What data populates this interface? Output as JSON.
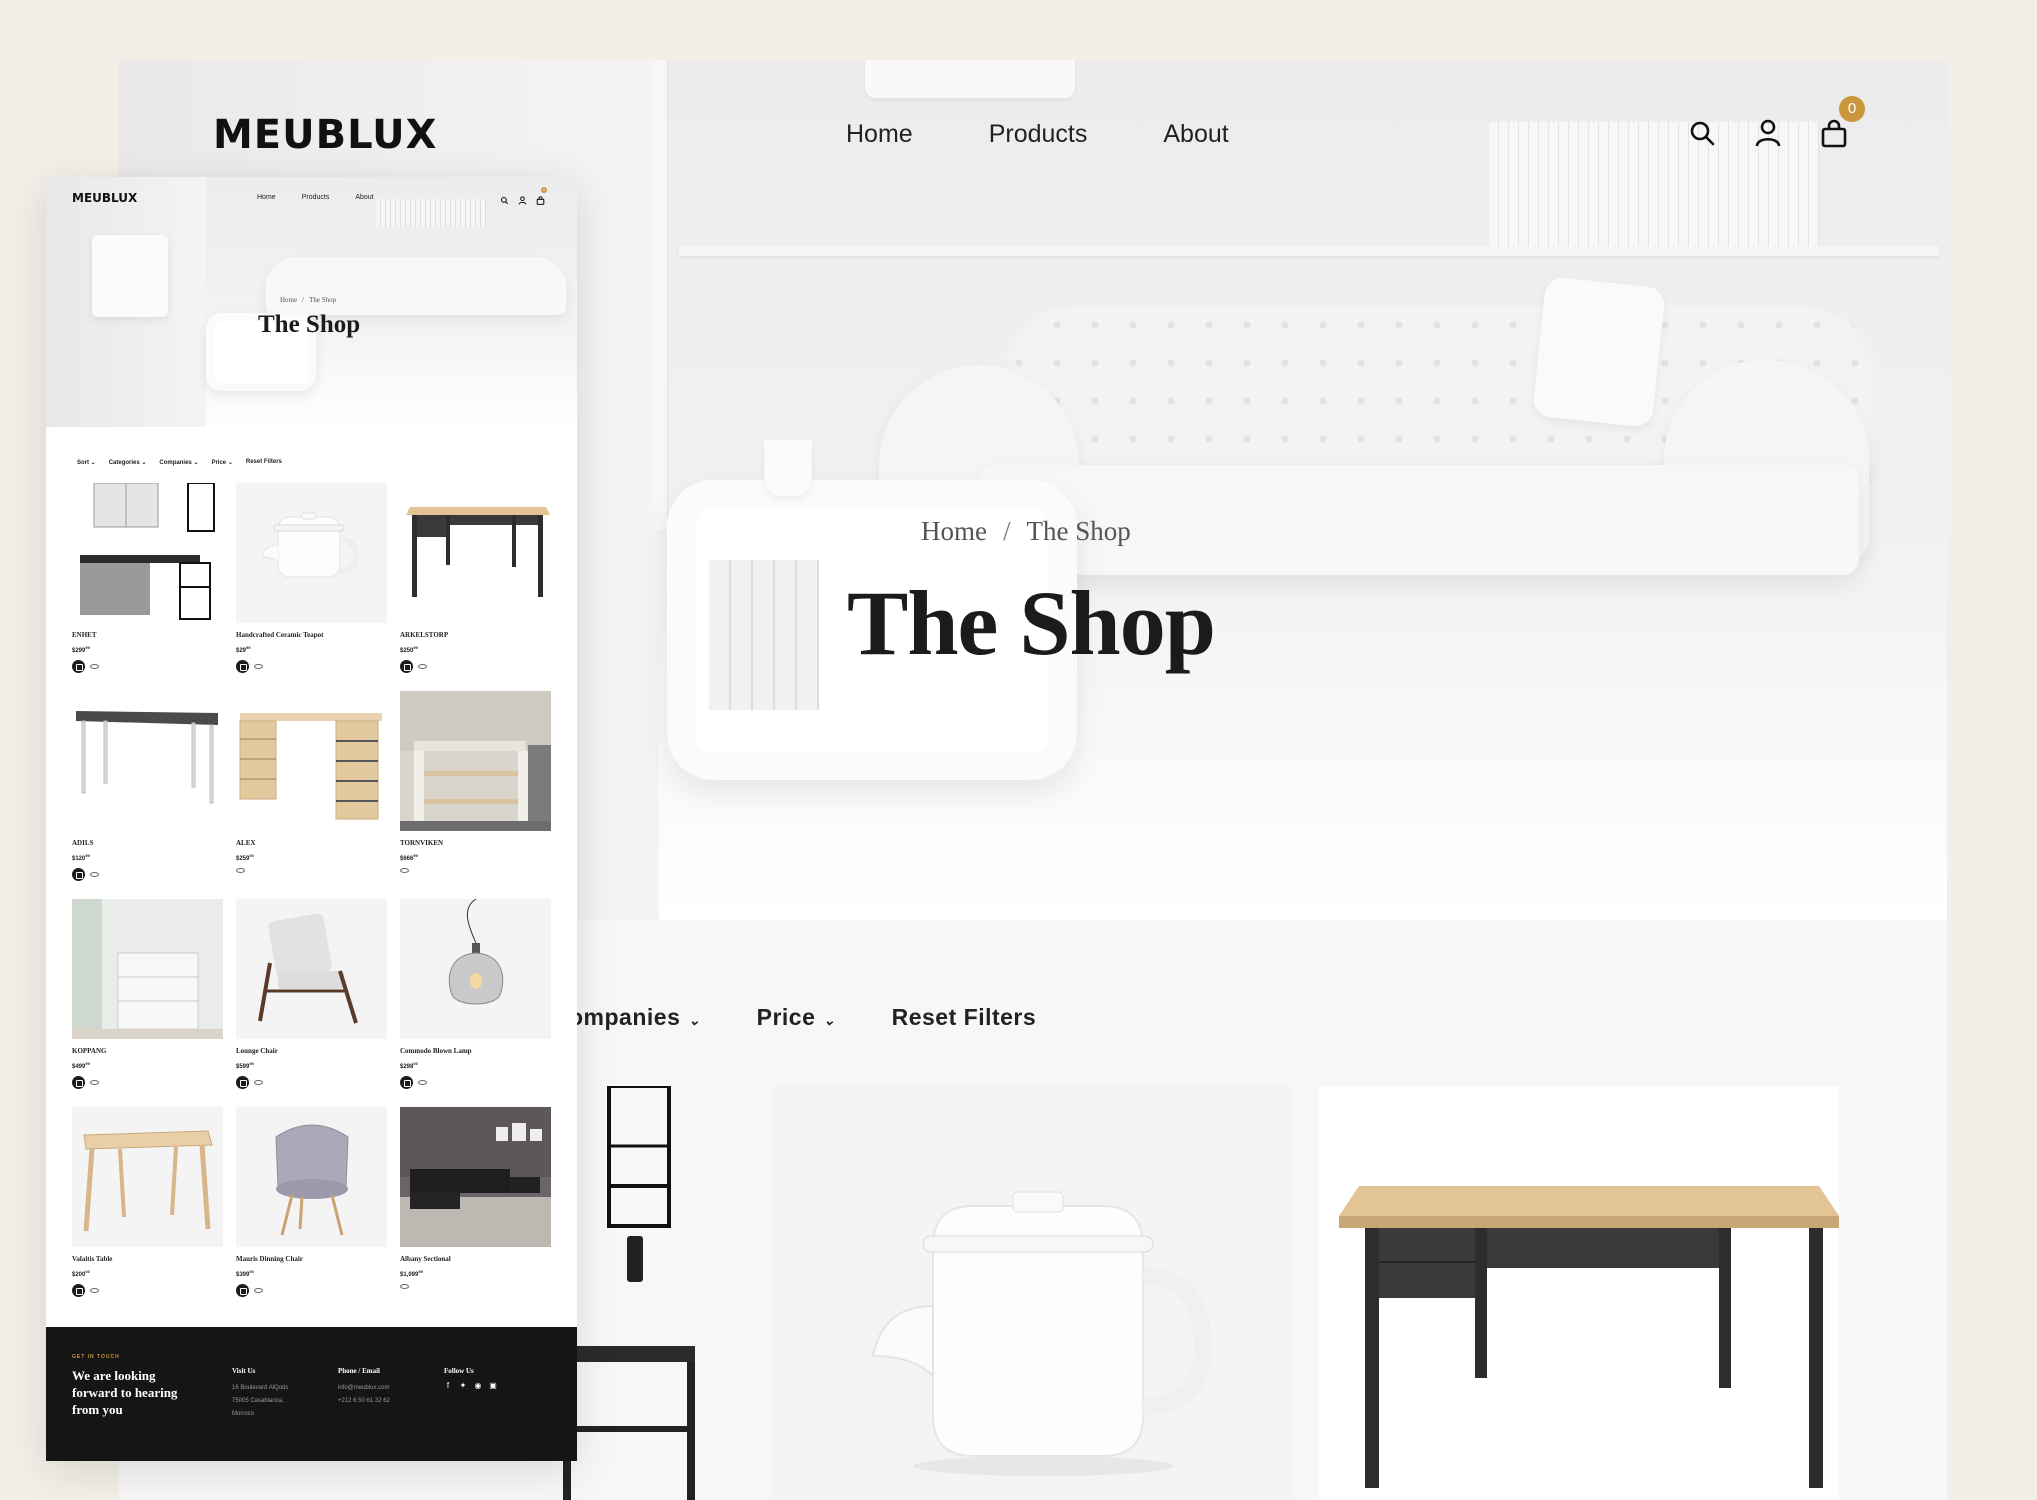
{
  "brand": "MEUBLUX",
  "nav": {
    "home": "Home",
    "products": "Products",
    "about": "About"
  },
  "cart_count": "0",
  "breadcrumb": {
    "home": "Home",
    "separator": "/",
    "current": "The Shop"
  },
  "page_title": "The Shop",
  "big_filters": {
    "companies": "ompanies",
    "price": "Price",
    "reset": "Reset Filters"
  },
  "mini_filters": {
    "sort": "Sort",
    "categories": "Categories",
    "companies": "Companies",
    "price": "Price",
    "reset": "Reset Filters"
  },
  "products": [
    {
      "name": "ENHET",
      "price": "$299",
      "cents": "99",
      "has_cart": true
    },
    {
      "name": "Handcrafted Ceramic Teapot",
      "price": "$29",
      "cents": "99",
      "has_cart": true
    },
    {
      "name": "ARKELSTORP",
      "price": "$250",
      "cents": "99",
      "has_cart": true
    },
    {
      "name": "ADILS",
      "price": "$120",
      "cents": "99",
      "has_cart": true
    },
    {
      "name": "ALEX",
      "price": "$259",
      "cents": "00",
      "has_cart": false
    },
    {
      "name": "TORNVIKEN",
      "price": "$666",
      "cents": "99",
      "has_cart": false
    },
    {
      "name": "KOPPANG",
      "price": "$499",
      "cents": "99",
      "has_cart": true
    },
    {
      "name": "Lounge Chair",
      "price": "$599",
      "cents": "99",
      "has_cart": true
    },
    {
      "name": "Commodo Blown Lamp",
      "price": "$298",
      "cents": "00",
      "has_cart": true
    },
    {
      "name": "Valaitis Table",
      "price": "$200",
      "cents": "00",
      "has_cart": true
    },
    {
      "name": "Mauris Dinning Chair",
      "price": "$399",
      "cents": "00",
      "has_cart": true
    },
    {
      "name": "Albany Sectional",
      "price": "$1,099",
      "cents": "99",
      "has_cart": false
    }
  ],
  "footer": {
    "kicker": "GET IN TOUCH",
    "heading": "We are looking forward to hearing from you",
    "visit_title": "Visit Us",
    "visit_lines": [
      "16 Boulevard AlQods",
      "75005 Casablanca,",
      "Morroco"
    ],
    "contact_title": "Phone / Email",
    "contact_lines": [
      "info@meublux.com",
      "+212 6 50 61 32 62"
    ],
    "follow_title": "Follow Us",
    "social": [
      "facebook-icon",
      "twitter-icon",
      "pinterest-icon",
      "instagram-icon"
    ]
  },
  "colors": {
    "accent": "#c9953d",
    "background": "#f3efe8",
    "footer": "#151515"
  }
}
